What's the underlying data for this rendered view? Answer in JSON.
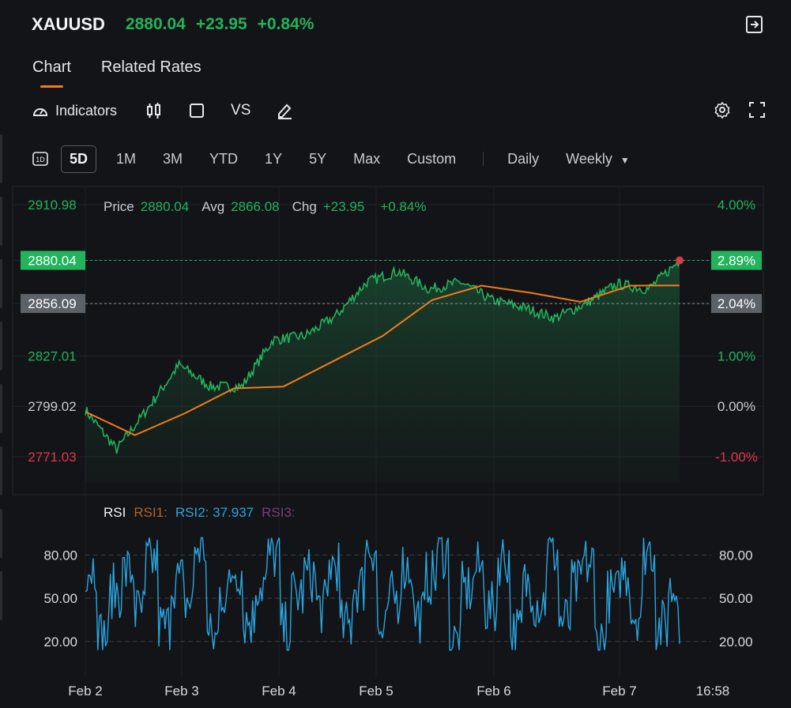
{
  "header": {
    "symbol": "XAUUSD",
    "price": "2880.04",
    "change": "+23.95",
    "change_pct": "+0.84%"
  },
  "tabs": [
    {
      "label": "Chart",
      "active": true
    },
    {
      "label": "Related Rates",
      "active": false
    }
  ],
  "toolbar": {
    "indicators_label": "Indicators",
    "compare_label": "VS"
  },
  "ranges": {
    "interval_1d_label": "1D",
    "items": [
      "5D",
      "1M",
      "3M",
      "YTD",
      "1Y",
      "5Y",
      "Max",
      "Custom"
    ],
    "selected": "5D",
    "frequency": [
      "Daily",
      "Weekly"
    ]
  },
  "price_info": {
    "price_label": "Price",
    "price_value": "2880.04",
    "avg_label": "Avg",
    "avg_value": "2866.08",
    "chg_label": "Chg",
    "chg_value": "+23.95",
    "chg_pct": "+0.84%"
  },
  "rsi_info": {
    "title": "RSI",
    "rsi1": "RSI1:",
    "rsi2": "RSI2: 37.937",
    "rsi3": "RSI3:"
  },
  "colors": {
    "up": "#22b35c",
    "down": "#e0364a",
    "avg_line": "#f07c1a",
    "rsi1": "#b0642a",
    "rsi2": "#2aa5e0",
    "rsi3": "#7a3f7a",
    "background": "#131417"
  },
  "chart_data": [
    {
      "type": "area",
      "series": [
        {
          "name": "Price",
          "x": [
            "Feb 2",
            "Feb 2",
            "Feb 3",
            "Feb 3",
            "Feb 3",
            "Feb 4",
            "Feb 4",
            "Feb 4",
            "Feb 5",
            "Feb 5",
            "Feb 5",
            "Feb 5",
            "Feb 6",
            "Feb 6",
            "Feb 6",
            "Feb 6",
            "Feb 7",
            "Feb 7",
            "Feb 7",
            "16:58"
          ],
          "values": [
            2797,
            2775,
            2798,
            2822,
            2810,
            2810,
            2836,
            2838,
            2849,
            2868,
            2874,
            2864,
            2868,
            2858,
            2854,
            2848,
            2856,
            2867,
            2864,
            2880.04
          ]
        },
        {
          "name": "Avg",
          "x": [
            "Feb 2",
            "Feb 2",
            "Feb 3",
            "Feb 3",
            "Feb 4",
            "Feb 4",
            "Feb 5",
            "Feb 5",
            "Feb 6",
            "Feb 6",
            "Feb 7",
            "Feb 7",
            "16:58"
          ],
          "values": [
            2796,
            2783,
            2795,
            2809,
            2810,
            2824,
            2838,
            2858,
            2866,
            2862,
            2857,
            2866,
            2866.08
          ]
        }
      ],
      "y_ticks": [
        "2910.98",
        "2880.04",
        "2856.09",
        "2827.01",
        "2799.02",
        "2771.03"
      ],
      "y_ticks_right": [
        "4.00%",
        "2.89%",
        "2.04%",
        "1.00%",
        "0.00%",
        "-1.00%"
      ],
      "ylim": [
        2771.03,
        2910.98
      ],
      "grid": true
    },
    {
      "type": "line",
      "series": [
        {
          "name": "RSI2",
          "values": [
            72,
            24,
            55,
            68,
            40,
            76,
            30,
            62,
            48,
            85,
            22,
            55,
            70,
            35,
            60,
            80,
            28,
            52,
            66,
            44,
            74,
            30,
            58,
            86,
            25,
            50,
            72,
            38,
            64,
            83,
            20,
            56,
            70,
            42,
            78,
            26,
            60,
            48,
            82,
            34,
            58,
            74,
            22,
            52,
            68,
            40,
            84,
            30,
            56,
            38
          ]
        }
      ],
      "y_ticks": [
        "80.00",
        "50.00",
        "20.00"
      ],
      "x_ticks": [
        "Feb 2",
        "Feb 3",
        "Feb 4",
        "Feb 5",
        "Feb 6",
        "Feb 7",
        "16:58"
      ],
      "ylim": [
        10,
        95
      ]
    }
  ]
}
